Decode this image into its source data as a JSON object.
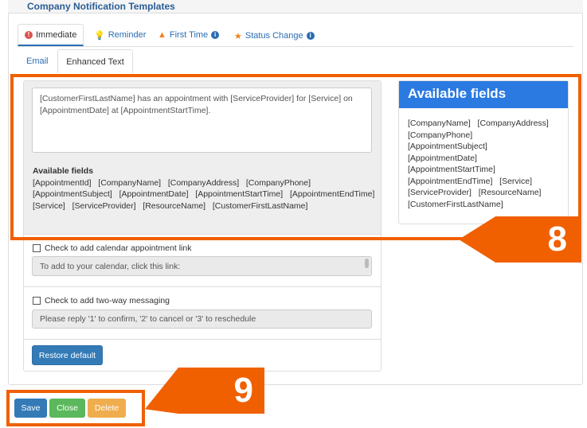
{
  "header": {
    "title": "Company Notification Templates"
  },
  "tabs": [
    {
      "label": "Immediate",
      "icon": "exclamation-circle-icon",
      "color": "#d9534f",
      "active": true
    },
    {
      "label": "Reminder",
      "icon": "lightbulb-icon",
      "color": "#f0ad4e"
    },
    {
      "label": "First Time",
      "icon": "warning-triangle-icon",
      "color": "#f0801e",
      "info": true
    },
    {
      "label": "Status Change",
      "icon": "star-icon",
      "color": "#f0801e",
      "info": true
    }
  ],
  "subtabs": [
    {
      "label": "Email"
    },
    {
      "label": "Enhanced Text",
      "active": true
    }
  ],
  "message": "[CustomerFirstLastName] has an appointment with [ServiceProvider] for [Service] on [AppointmentDate] at [AppointmentStartTime].",
  "available_fields": {
    "label": "Available fields",
    "text": "[AppointmentId]   [CompanyName]   [CompanyAddress]   [CompanyPhone]   [AppointmentSubject]   [AppointmentDate]   [AppointmentStartTime]   [AppointmentEndTime]   [Service]   [ServiceProvider]   [ResourceName]   [CustomerFirstLastName]"
  },
  "right_panel": {
    "title": "Available fields",
    "items": [
      "[CompanyName]   [CompanyAddress]",
      "[CompanyPhone]",
      "[AppointmentSubject]",
      "[AppointmentDate]",
      "[AppointmentStartTime]",
      "[AppointmentEndTime]   [Service]",
      "[ServiceProvider]   [ResourceName]",
      "[CustomerFirstLastName]"
    ]
  },
  "calendar": {
    "label": "Check to add calendar appointment link",
    "text": "To add to your calendar, click this link:",
    "checked": false
  },
  "twoway": {
    "label": "Check to add two-way messaging",
    "text": "Please reply '1' to confirm, '2' to cancel or '3' to reschedule",
    "checked": false
  },
  "buttons": {
    "restore": "Restore default",
    "save": "Save",
    "close": "Close",
    "delete": "Delete"
  },
  "callouts": {
    "a": "8",
    "b": "9"
  },
  "colors": {
    "primary": "#337ab7",
    "success": "#5cb85c",
    "warning": "#f0ad4e",
    "callout": "#f06000",
    "panel_head": "#2a7ae2"
  }
}
